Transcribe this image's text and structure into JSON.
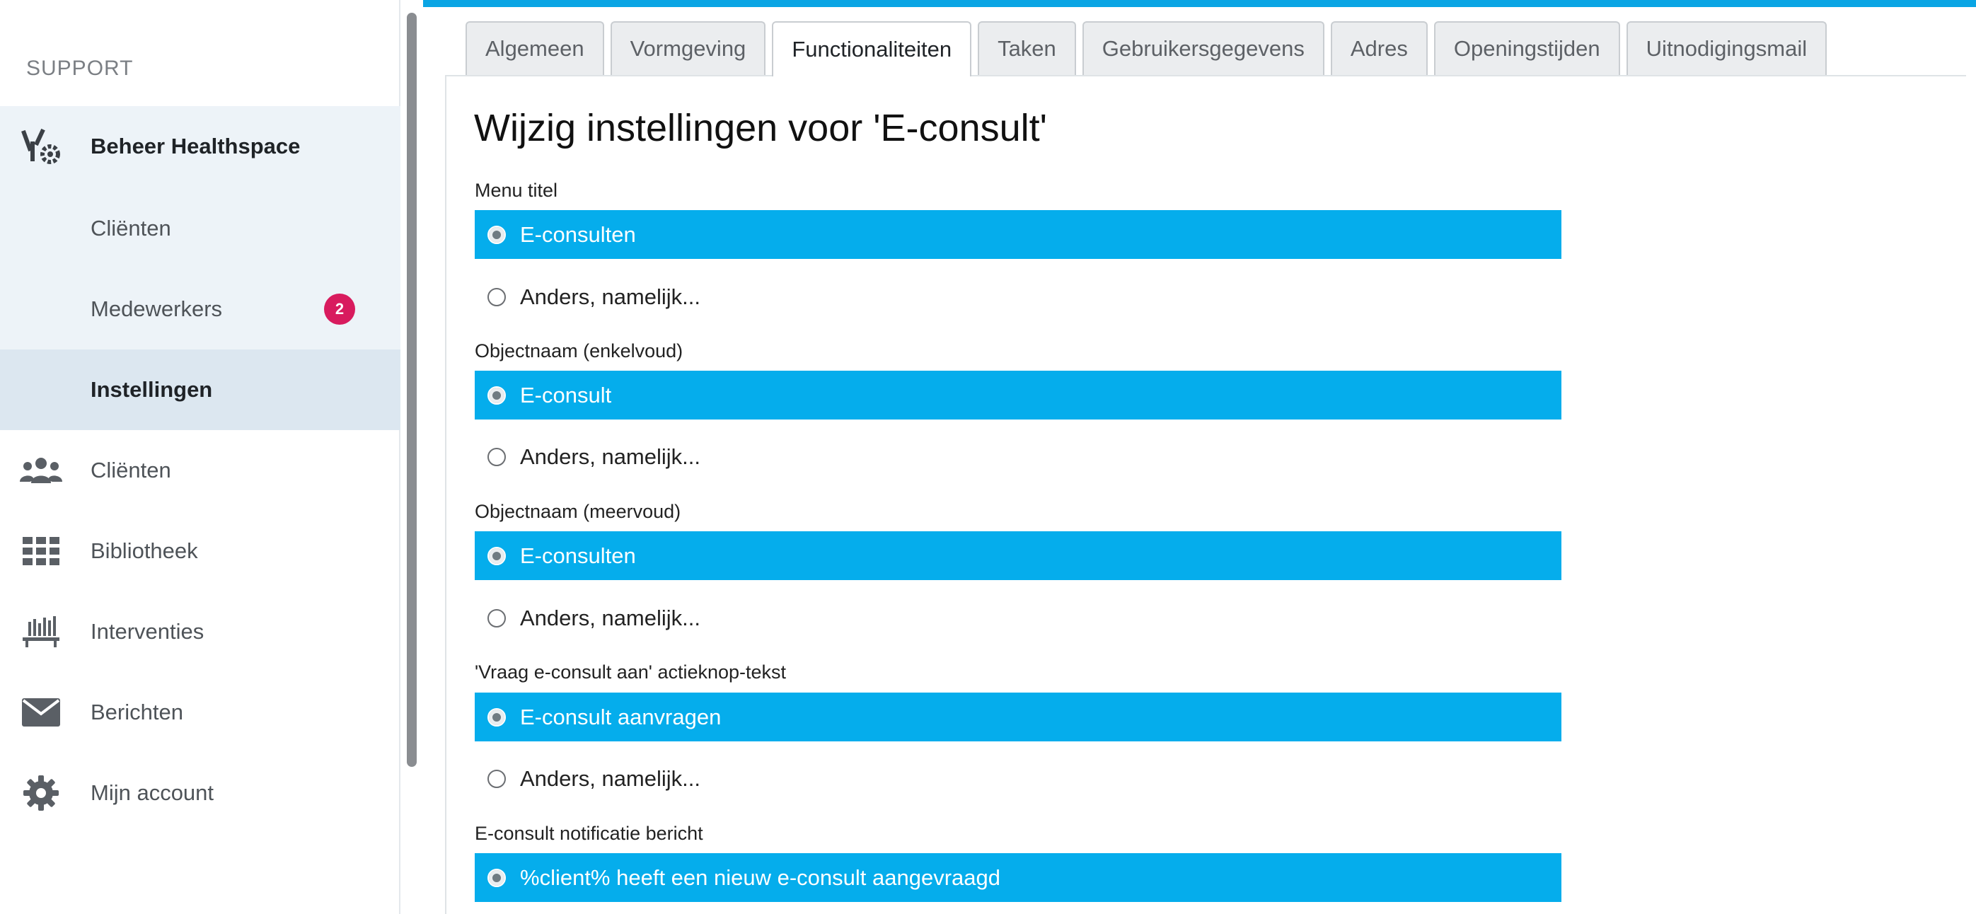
{
  "sidebar": {
    "header": "SUPPORT",
    "items": [
      {
        "label": "Beheer Healthspace"
      },
      {
        "label": "Cliënten"
      },
      {
        "label": "Medewerkers",
        "badge": "2"
      },
      {
        "label": "Instellingen"
      },
      {
        "label": "Cliënten"
      },
      {
        "label": "Bibliotheek"
      },
      {
        "label": "Interventies"
      },
      {
        "label": "Berichten"
      },
      {
        "label": "Mijn account"
      }
    ]
  },
  "tabs": [
    {
      "label": "Algemeen"
    },
    {
      "label": "Vormgeving"
    },
    {
      "label": "Functionaliteiten",
      "active": true
    },
    {
      "label": "Taken"
    },
    {
      "label": "Gebruikersgegevens"
    },
    {
      "label": "Adres"
    },
    {
      "label": "Openingstijden"
    },
    {
      "label": "Uitnodigingsmail"
    }
  ],
  "page": {
    "title": "Wijzig instellingen voor 'E-consult'",
    "fields": [
      {
        "label": "Menu titel",
        "options": [
          "E-consulten",
          "Anders, namelijk..."
        ]
      },
      {
        "label": "Objectnaam (enkelvoud)",
        "options": [
          "E-consult",
          "Anders, namelijk..."
        ]
      },
      {
        "label": "Objectnaam (meervoud)",
        "options": [
          "E-consulten",
          "Anders, namelijk..."
        ]
      },
      {
        "label": "'Vraag e-consult aan' actieknop-tekst",
        "options": [
          "E-consult aanvragen",
          "Anders, namelijk..."
        ]
      },
      {
        "label": "E-consult notificatie bericht",
        "options": [
          "%client% heeft een nieuw e-consult aangevraagd"
        ]
      }
    ]
  },
  "colors": {
    "accent": "#05adec",
    "topbar": "#0aa5e4",
    "badge": "#d81b5e"
  }
}
